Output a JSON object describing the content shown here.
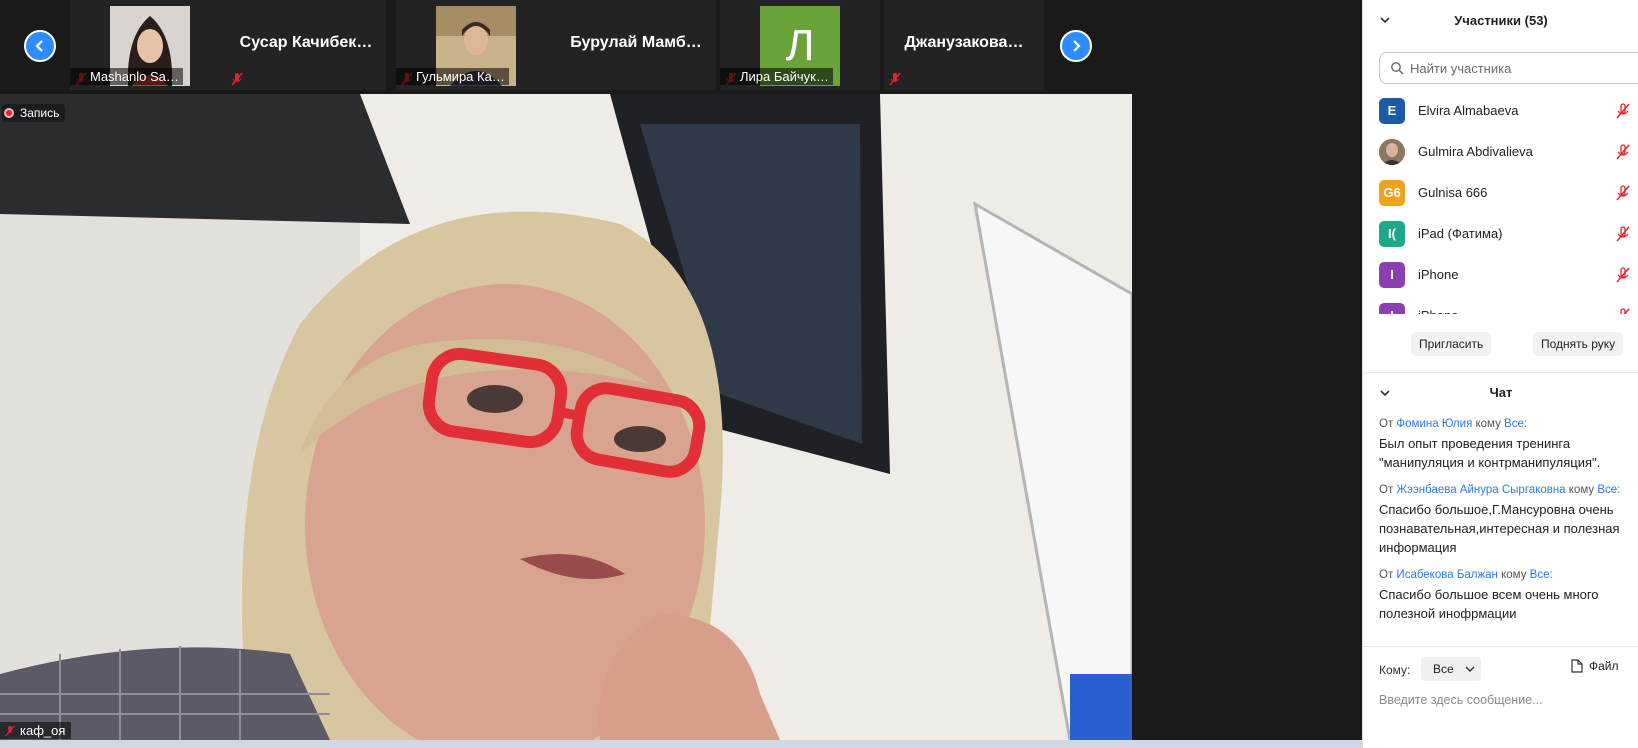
{
  "gallery": {
    "thumbnails": [
      {
        "caption": "Mashanlo Sa…",
        "type": "photo"
      },
      {
        "name": "Сусар  Качибек…",
        "type": "name"
      },
      {
        "caption": "Гульмира Ка…",
        "type": "photo"
      },
      {
        "name": "Бурулай  Мамб…",
        "type": "name"
      },
      {
        "caption": "Лира Байчук…",
        "type": "letter",
        "letter": "Л"
      },
      {
        "name": "Джанузакова…",
        "type": "name"
      }
    ]
  },
  "main": {
    "recording_label": "Запись",
    "speaker_name": "каф_оя"
  },
  "participants": {
    "title": "Участники (53)",
    "search_placeholder": "Найти участника",
    "list": [
      {
        "initials": "E",
        "name": "Elvira Almabaeva",
        "color": "#1e5aa8"
      },
      {
        "initials": "",
        "name": "Gulmira Abdivalieva",
        "color": "#7a5a42",
        "photo": true
      },
      {
        "initials": "G6",
        "name": "Gulnisa 666",
        "color": "#f0a21c"
      },
      {
        "initials": "I(",
        "name": "iPad (Фатима)",
        "color": "#1ea88a"
      },
      {
        "initials": "I",
        "name": "iPhone",
        "color": "#8b3fb0"
      },
      {
        "initials": "I",
        "name": "iPhone",
        "color": "#8b3fb0"
      }
    ],
    "invite_label": "Пригласить",
    "raise_hand_label": "Поднять руку"
  },
  "chat": {
    "title": "Чат",
    "messages": [
      {
        "from_prefix": "От",
        "sender": "Фомина Юлия",
        "to_prefix": "кому",
        "recipient": "Все:",
        "text": "Был опыт проведения тренинга \"манипуляция и контрманипуляция\"."
      },
      {
        "from_prefix": "От",
        "sender": "Жээнбаева Айнура Сыргаковна",
        "to_prefix": "кому",
        "recipient": "Все:",
        "text": "Спасибо большое,Г.Мансуровна очень познавательная,интересная и полезная информация"
      },
      {
        "from_prefix": "От",
        "sender": "Исабекова Балжан",
        "to_prefix": "кому",
        "recipient": "Все:",
        "text": "Спасибо большое всем  очень много полезной инофрмации"
      }
    ],
    "to_label": "Кому:",
    "to_value": "Все",
    "file_label": "Файл",
    "input_placeholder": "Введите здесь сообщение..."
  },
  "colors": {
    "accent": "#2d8cff",
    "link": "#2d7be0",
    "mute": "#e0242f"
  }
}
